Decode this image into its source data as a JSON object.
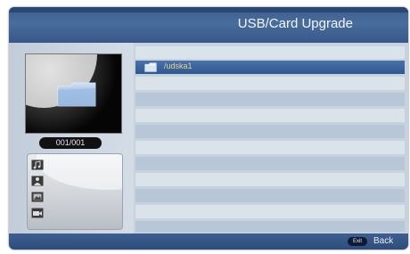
{
  "header": {
    "title": "USB/Card Upgrade"
  },
  "preview": {
    "counter": "001/001",
    "icon": "folder-icon"
  },
  "media_types": [
    {
      "icon": "music-icon"
    },
    {
      "icon": "person-icon"
    },
    {
      "icon": "photo-icon"
    },
    {
      "icon": "video-icon"
    }
  ],
  "file_list": {
    "items": [
      {
        "label": "/udska1",
        "icon": "folder-icon",
        "selected": true
      }
    ],
    "total_rows": 12
  },
  "footer": {
    "exit_key": "Exit",
    "back_label": "Back"
  },
  "colors": {
    "header_bg": "#486d9c",
    "selected_row": "#2f5790",
    "row_dark": "#b8c7d8",
    "row_light": "#dae2ea",
    "folder_label": "#e8d48a"
  }
}
